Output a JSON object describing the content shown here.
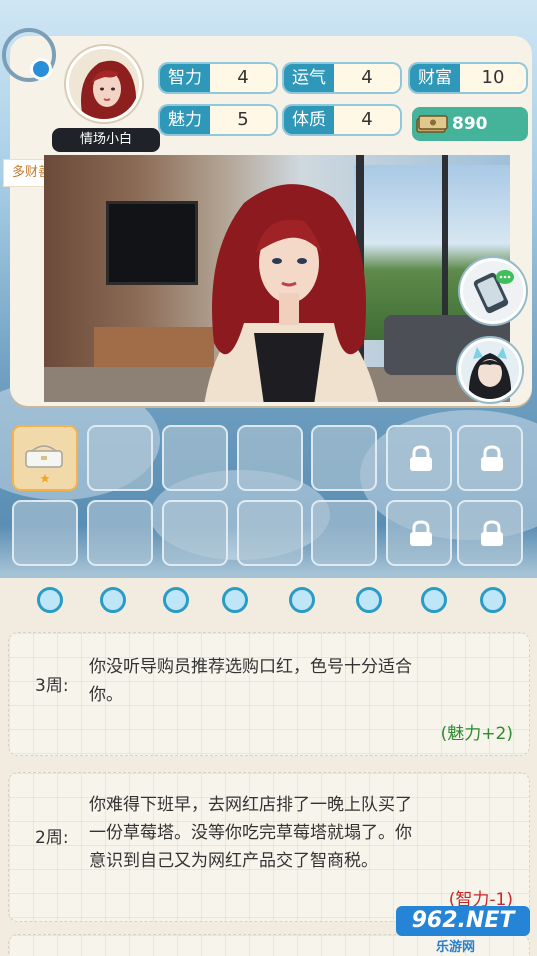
{
  "player": {
    "name": "情场小白",
    "title": "多财善贾"
  },
  "stats": [
    {
      "label": "智力",
      "value": "4"
    },
    {
      "label": "运气",
      "value": "4"
    },
    {
      "label": "财富",
      "value": "10"
    },
    {
      "label": "魅力",
      "value": "5"
    },
    {
      "label": "体质",
      "value": "4"
    }
  ],
  "money": "890",
  "inventory": {
    "rows": 2,
    "cols": 7,
    "filled_slots": [
      {
        "index": 0,
        "item_icon": "handbag-icon",
        "star": true
      }
    ],
    "locked_slots": [
      5,
      6,
      12,
      13
    ]
  },
  "week_dots": 8,
  "entries": [
    {
      "week": "3周:",
      "text_lines": [
        "你没听导购员推荐选购口红，色号十分适合",
        "你。"
      ],
      "effect": "(魅力+2)",
      "effect_color": "#2e8b2e"
    },
    {
      "week": "2周:",
      "text_lines": [
        "你难得下班早，去网红店排了一晚上队买了",
        "一份草莓塔。没等你吃完草莓塔就塌了。你",
        "意识到自己又为网红产品交了智商税。"
      ],
      "effect": "(智力-1)",
      "effect_color": "#c62828"
    }
  ],
  "watermark": {
    "logo": "962.NET",
    "sub": "乐游网"
  }
}
